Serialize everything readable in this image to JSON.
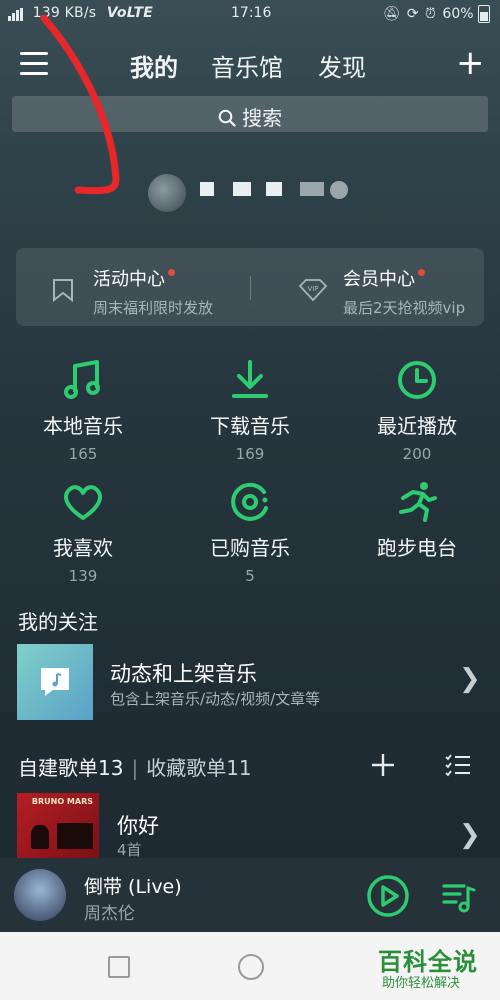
{
  "status_bar": {
    "network_speed": "139 KB/s",
    "volte": "VoLTE",
    "time": "17:16",
    "battery": "60%"
  },
  "header": {
    "tabs": [
      {
        "label": "我的",
        "active": true
      },
      {
        "label": "音乐馆",
        "active": false
      },
      {
        "label": "发现",
        "active": false
      }
    ],
    "search_label": "搜索",
    "plus_symbol": "+"
  },
  "activity_card": {
    "left": {
      "title": "活动中心",
      "subtitle": "周末福利限时发放",
      "icon": "bookmark-icon"
    },
    "right": {
      "title": "会员中心",
      "subtitle": "最后2天抢视频vip",
      "icon": "vip-diamond-icon",
      "icon_text": "VIP"
    }
  },
  "grid": [
    {
      "label": "本地音乐",
      "count": "165",
      "icon": "music-note-icon"
    },
    {
      "label": "下载音乐",
      "count": "169",
      "icon": "download-icon"
    },
    {
      "label": "最近播放",
      "count": "200",
      "icon": "clock-icon"
    },
    {
      "label": "我喜欢",
      "count": "139",
      "icon": "heart-icon"
    },
    {
      "label": "已购音乐",
      "count": "5",
      "icon": "purchased-disc-icon"
    },
    {
      "label": "跑步电台",
      "count": "",
      "icon": "running-icon"
    }
  ],
  "follow": {
    "section_title": "我的关注",
    "item_title": "动态和上架音乐",
    "item_subtitle": "包含上架音乐/动态/视频/文章等"
  },
  "playlists": {
    "created_tab": "自建歌单13",
    "separator": "|",
    "collected_tab": "收藏歌单11",
    "first_item": {
      "title": "你好",
      "count": "4首"
    },
    "album_text": "BRUNO MARS"
  },
  "player": {
    "title": "倒带 (Live)",
    "artist": "周杰伦"
  },
  "watermark": {
    "title": "百科全说",
    "subtitle": "助你轻松解决"
  },
  "colors": {
    "accent_green": "#2ecc71",
    "red_dot": "#e34b3a",
    "annotation_arrow": "#e8272b"
  }
}
